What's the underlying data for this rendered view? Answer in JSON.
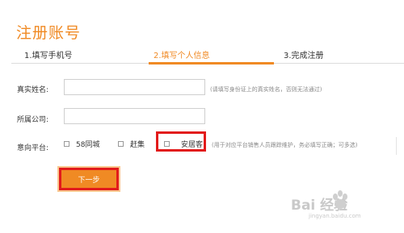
{
  "page": {
    "title": "注册账号"
  },
  "steps": [
    {
      "label": "1.填写手机号",
      "active": false
    },
    {
      "label": "2.填写个人信息",
      "active": true
    },
    {
      "label": "3.完成注册",
      "active": false
    }
  ],
  "form": {
    "real_name": {
      "label": "真实姓名:",
      "value": "",
      "hint": "(请填写身份证上的真实姓名，否则无法通过)"
    },
    "company": {
      "label": "所属公司:",
      "value": ""
    },
    "platform": {
      "label": "意向平台:",
      "options": [
        {
          "label": "58同城",
          "checked": false
        },
        {
          "label": "赶集",
          "checked": false
        },
        {
          "label": "安居客",
          "checked": false,
          "highlighted": true
        }
      ],
      "hint": "(用于对应平台销售人员跟踪维护，务必填写正确；可多选)"
    }
  },
  "buttons": {
    "next_label": "下一步"
  },
  "watermark": {
    "main": "Bai 经验",
    "sub": "jingyan.baidu.com"
  },
  "colors": {
    "accent": "#f08a24",
    "highlight": "#e21b1b"
  }
}
